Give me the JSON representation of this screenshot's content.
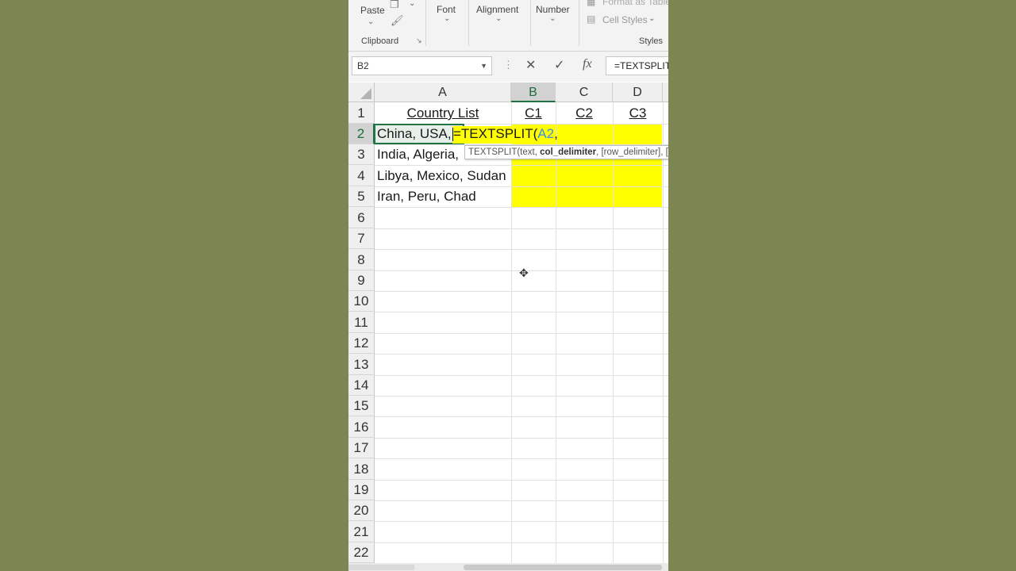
{
  "ribbon": {
    "paste_label": "Paste",
    "clipboard_group": "Clipboard",
    "font_group": "Font",
    "alignment_group": "Alignment",
    "number_group": "Number",
    "format_as_table": "Format as Table",
    "cell_styles": "Cell Styles",
    "styles_group": "Styles"
  },
  "formula_bar": {
    "name_box": "B2",
    "cancel_symbol": "✕",
    "enter_symbol": "✓",
    "fx_symbol": "fx",
    "formula_text": "=TEXTSPLIT"
  },
  "columns": [
    "A",
    "B",
    "C",
    "D"
  ],
  "rows": [
    "1",
    "2",
    "3",
    "4",
    "5",
    "6",
    "7",
    "8",
    "9",
    "10",
    "11",
    "12",
    "13",
    "14",
    "15",
    "16",
    "17",
    "18",
    "19",
    "20",
    "21",
    "22"
  ],
  "cells": {
    "A1": "Country List",
    "B1": "C1",
    "C1": "C2",
    "D1": "C3",
    "A2": "China, USA, I",
    "A3": "India, Algeria,",
    "A4": "Libya, Mexico, Sudan",
    "A5": "Iran, Peru, Chad"
  },
  "editing": {
    "fn_part": "=TEXTSPLIT(",
    "ref_part": "A2",
    "trail_part": ","
  },
  "tooltip": {
    "fn": "TEXTSPLIT(text, ",
    "bold_arg": "col_delimiter",
    "rest": ", [row_delimiter], [i"
  },
  "colors": {
    "highlight": "#ffff00",
    "selection": "#217346",
    "background": "#7d8653"
  }
}
